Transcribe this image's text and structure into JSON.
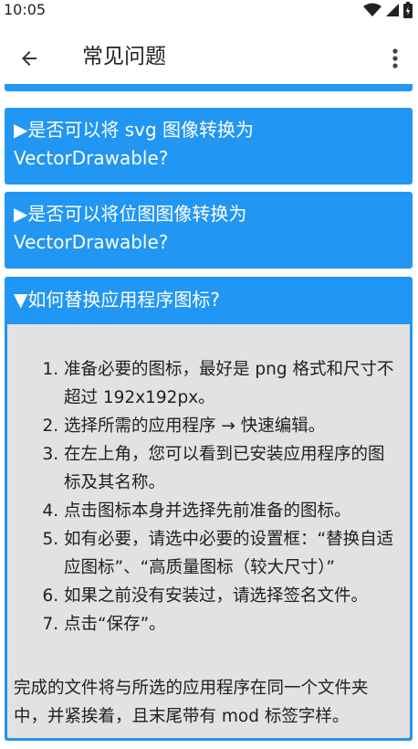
{
  "status": {
    "time": "10:05"
  },
  "app_bar": {
    "title": "常见问题"
  },
  "questions": [
    {
      "label": "▶是否可以将 svg 图像转换为 VectorDrawable?"
    },
    {
      "label": "▶是否可以将位图图像转换为 VectorDrawable?"
    },
    {
      "label": "▼如何替换应用程序图标?"
    }
  ],
  "answer": {
    "steps": [
      "准备必要的图标，最好是 png 格式和尺寸不超过 192x192px。",
      "选择所需的应用程序 → 快速编辑。",
      "在左上角，您可以看到已安装应用程序的图标及其名称。",
      "点击图标本身并选择先前准备的图标。",
      "如有必要，请选中必要的设置框：“替换自适应图标”、“高质量图标（较大尺寸）”",
      "如果之前没有安装过，请选择签名文件。",
      "点击“保存”。"
    ],
    "tail": "完成的文件将与所选的应用程序在同一个文件夹中，并紧挨着，且末尾带有 mod 标签字样。"
  },
  "colors": {
    "accent": "#2196f3",
    "answer_bg": "#e2e2e2"
  },
  "icons": {
    "back": "arrow-left-icon",
    "menu": "more-vert-icon",
    "wifi": "wifi-icon",
    "signal": "signal-icon",
    "battery": "battery-icon"
  }
}
